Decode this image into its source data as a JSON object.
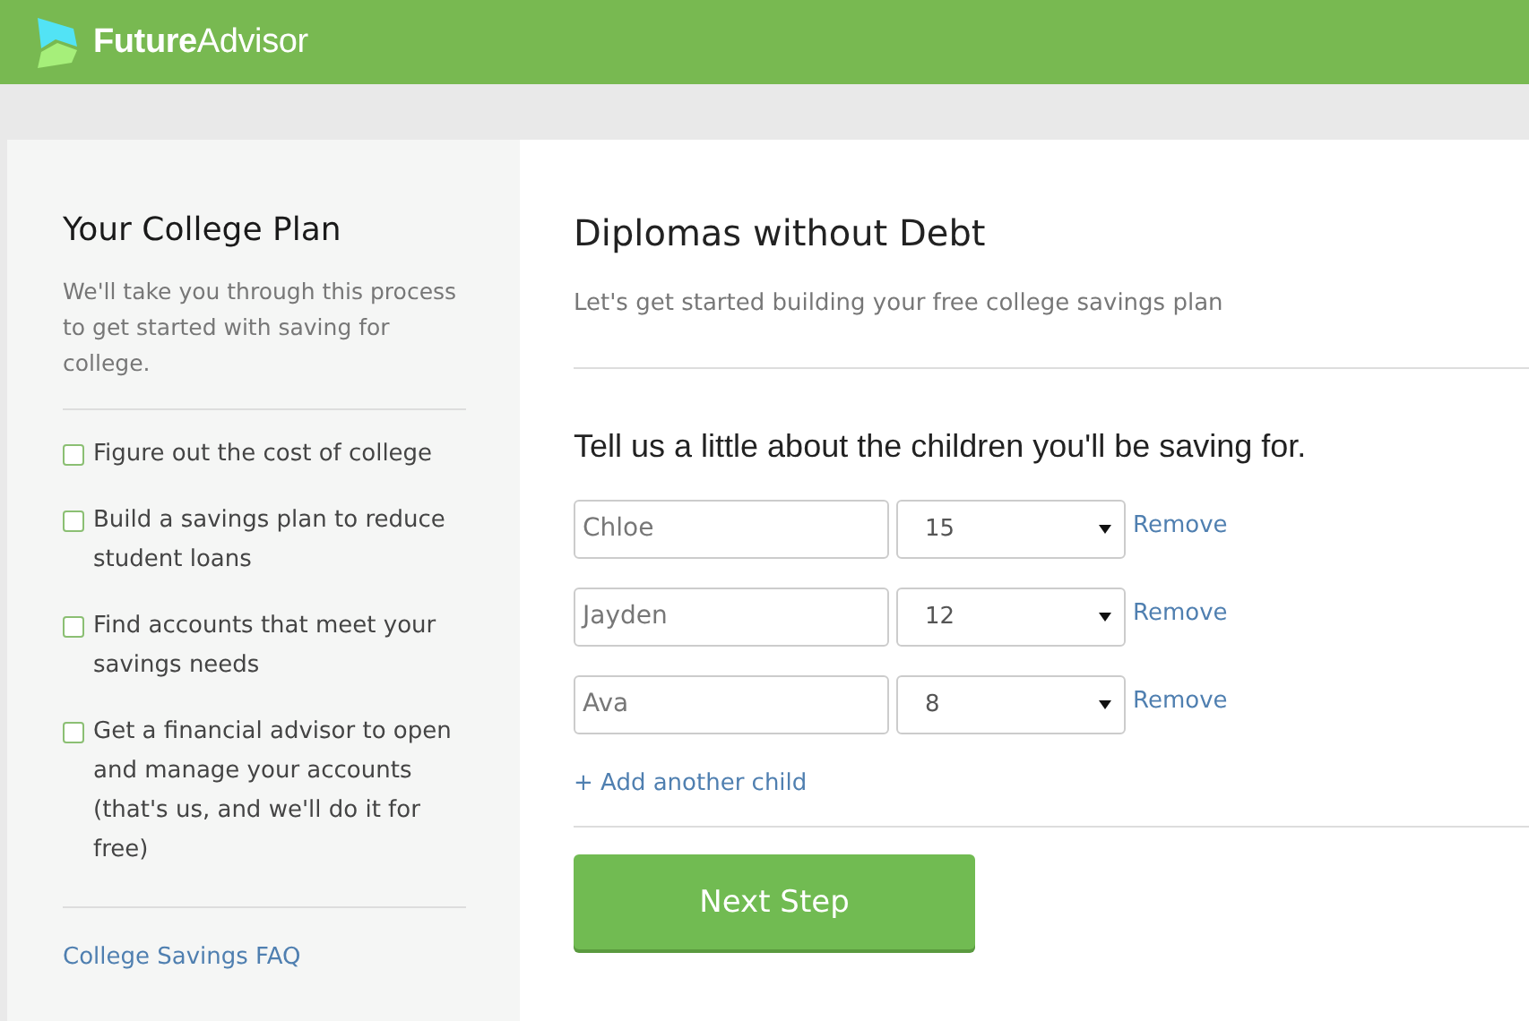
{
  "header": {
    "brand_bold": "Future",
    "brand_rest": "Advisor"
  },
  "sidebar": {
    "title": "Your College Plan",
    "intro": "We'll take you through this process to get started with saving for college.",
    "steps": [
      {
        "label": "Figure out the cost of college",
        "checked": false
      },
      {
        "label": "Build a savings plan to reduce student loans",
        "checked": false
      },
      {
        "label": "Find accounts that meet your savings needs",
        "checked": false
      },
      {
        "label": "Get a financial advisor to open and manage your accounts (that's us, and we'll do it for free)",
        "checked": false
      }
    ],
    "faq_link": "College Savings FAQ"
  },
  "main": {
    "title": "Diplomas without Debt",
    "subtitle": "Let's get started building your free college savings plan",
    "question": "Tell us a little about the children you'll be saving for.",
    "children": [
      {
        "name": "Chloe",
        "age": "15",
        "remove": "Remove"
      },
      {
        "name": "Jayden",
        "age": "12",
        "remove": "Remove"
      },
      {
        "name": "Ava",
        "age": "8",
        "remove": "Remove"
      }
    ],
    "add_link": "+ Add another child",
    "next_button": "Next Step"
  }
}
